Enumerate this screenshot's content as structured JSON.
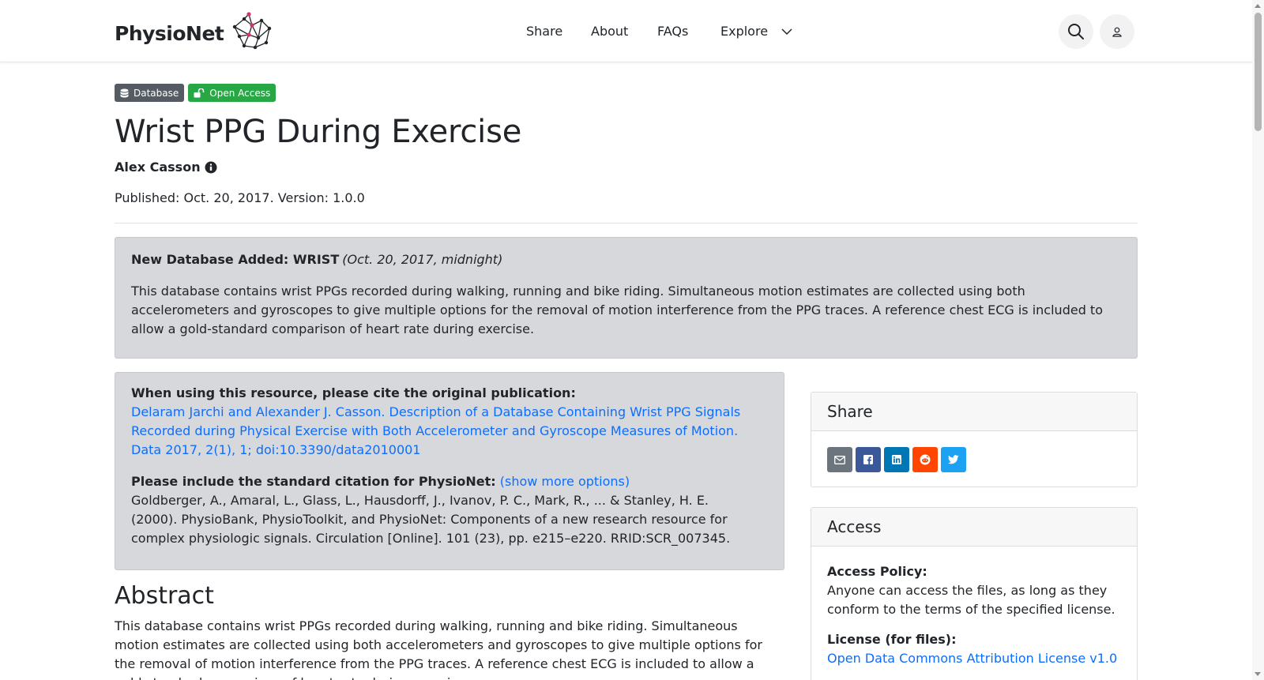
{
  "header": {
    "brand": "PhysioNet",
    "nav": [
      {
        "label": "Share"
      },
      {
        "label": "About"
      },
      {
        "label": "FAQs"
      },
      {
        "label": "Explore"
      }
    ],
    "search_icon": "search-icon",
    "user_icon": "user-icon"
  },
  "badges": {
    "type": "Database",
    "access": "Open Access"
  },
  "project": {
    "title": "Wrist PPG During Exercise",
    "author": "Alex Casson",
    "published": "Published: Oct. 20, 2017. Version: 1.0.0"
  },
  "news": {
    "headline": "New Database Added: WRIST",
    "date": "(Oct. 20, 2017, midnight)",
    "body": "This database contains wrist PPGs recorded during walking, running and bike riding. Simultaneous motion estimates are collected using both accelerometers and gyroscopes to give multiple options for the removal of motion interference from the PPG traces. A reference chest ECG is included to allow a gold-standard comparison of heart rate during exercise."
  },
  "citation": {
    "heading": "When using this resource, please cite the original publication:",
    "publication": "Delaram Jarchi and Alexander J. Casson. Description of a Database Containing Wrist PPG Signals Recorded during Physical Exercise with Both Accelerometer and Gyroscope Measures of Motion. Data 2017, 2(1), 1; doi:10.3390/data2010001",
    "standard_heading": "Please include the standard citation for PhysioNet:",
    "show_more": "(show more options)",
    "standard_text": "Goldberger, A., Amaral, L., Glass, L., Hausdorff, J., Ivanov, P. C., Mark, R., ... & Stanley, H. E. (2000). PhysioBank, PhysioToolkit, and PhysioNet: Components of a new research resource for complex physiologic signals. Circulation [Online]. 101 (23), pp. e215–e220. RRID:SCR_007345."
  },
  "abstract": {
    "title": "Abstract",
    "body": "This database contains wrist PPGs recorded during walking, running and bike riding. Simultaneous motion estimates are collected using both accelerometers and gyroscopes to give multiple options for the removal of motion interference from the PPG traces. A reference chest ECG is included to allow a gold-standard comparison of heart rate during exercise."
  },
  "sidebar": {
    "share": {
      "title": "Share",
      "buttons": [
        {
          "icon": "email-icon",
          "color": "#6c757d"
        },
        {
          "icon": "facebook-icon",
          "color": "#3b5998"
        },
        {
          "icon": "linkedin-icon",
          "color": "#0077b5"
        },
        {
          "icon": "reddit-icon",
          "color": "#ff4500"
        },
        {
          "icon": "twitter-icon",
          "color": "#1da1f2"
        }
      ]
    },
    "access": {
      "title": "Access",
      "policy_label": "Access Policy:",
      "policy_text": "Anyone can access the files, as long as they conform to the terms of the specified license.",
      "license_label": "License (for files):",
      "license_link": "Open Data Commons Attribution License v1.0"
    }
  },
  "colors": {
    "link": "#0d6efd",
    "open_access": "#28a745",
    "database_badge": "#545b62",
    "alert_bg": "#d6d8db"
  }
}
